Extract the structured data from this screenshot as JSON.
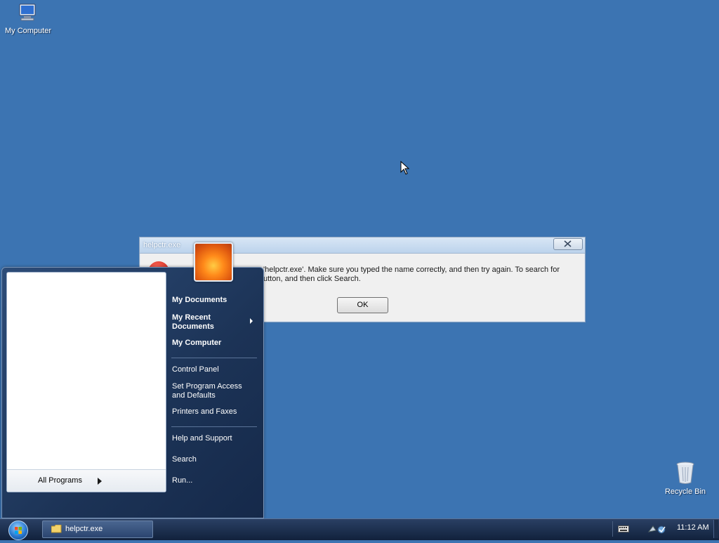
{
  "desktop": {
    "icons": [
      {
        "label": "My Computer"
      },
      {
        "label": "Recycle Bin"
      }
    ]
  },
  "dialog": {
    "title": "helpctr.exe",
    "message_line1": "'helpctr.exe'. Make sure you typed the name correctly, and then try again. To search for",
    "message_line2": "utton, and then click Search.",
    "ok_label": "OK"
  },
  "start_menu": {
    "all_programs": "All Programs",
    "right_items": [
      {
        "label": "My Documents"
      },
      {
        "label": "My Recent Documents",
        "line1": "My Recent",
        "line2": "Documents"
      },
      {
        "label": "My Computer"
      },
      {
        "label": "Control Panel"
      },
      {
        "label": "Set Program Access and Defaults",
        "line1": "Set Program Access",
        "line2": "and Defaults"
      },
      {
        "label": "Printers and Faxes"
      },
      {
        "label": "Help and Support"
      },
      {
        "label": "Search"
      },
      {
        "label": "Run..."
      }
    ]
  },
  "taskbar": {
    "tasks": [
      {
        "label": "helpctr.exe"
      }
    ],
    "clock": "11:12 AM"
  },
  "colors": {
    "desktop_bg": "#3c74b2",
    "taskbar": "#1a2e50"
  }
}
